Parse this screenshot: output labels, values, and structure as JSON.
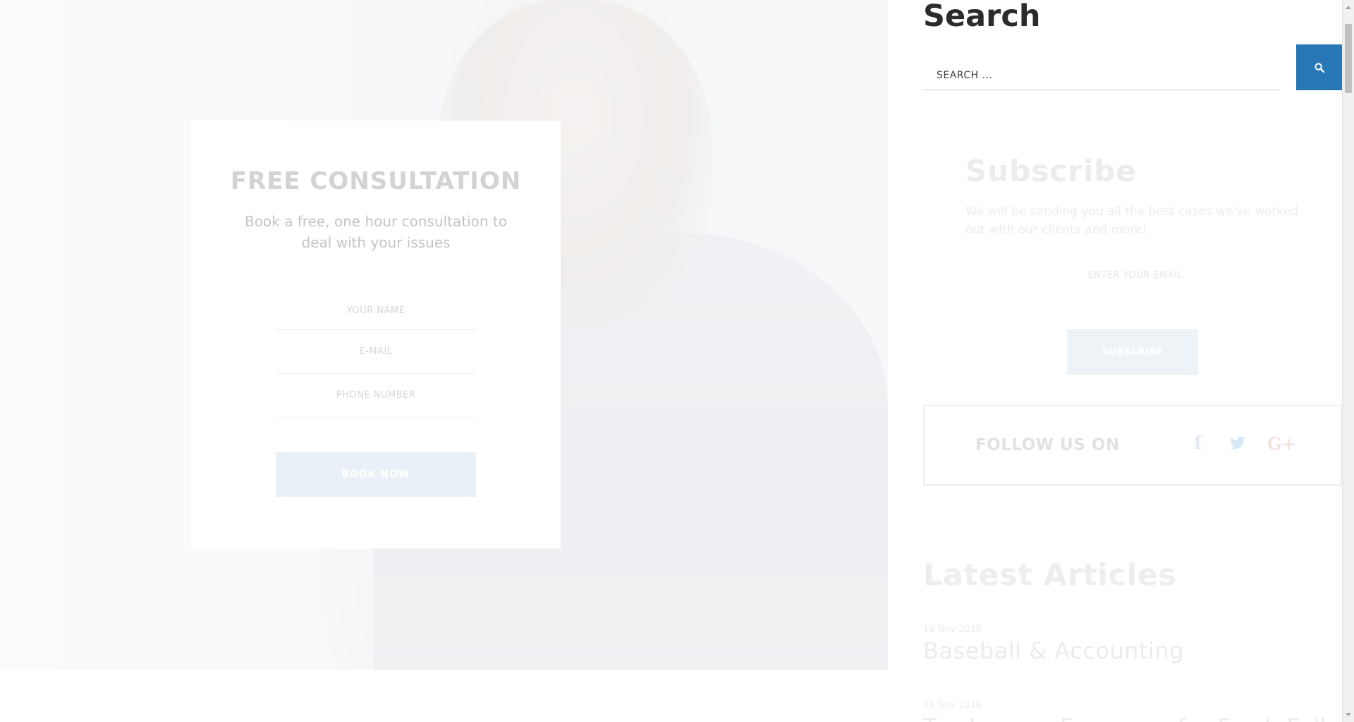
{
  "consultation": {
    "title": "FREE CONSULTATION",
    "subtitle": "Book a free, one hour consultation to deal with your issues",
    "name_placeholder": "YOUR NAME",
    "email_placeholder": "E-MAIL",
    "phone_placeholder": "PHONE NUMBER",
    "button_label": "BOOK NOW"
  },
  "search": {
    "title": "Search",
    "placeholder": "SEARCH ...",
    "button_icon": "search-icon",
    "accent_color": "#2878b8"
  },
  "subscribe": {
    "title": "Subscribe",
    "text": "We will be sending you all the best cases we've worked out with our clients and more!",
    "email_placeholder": "ENTER YOUR EMAIL",
    "button_label": "SUBSCRIBE"
  },
  "follow": {
    "label": "FOLLOW US ON",
    "networks": [
      {
        "name": "facebook",
        "icon": "facebook-icon",
        "glyph": "f"
      },
      {
        "name": "twitter",
        "icon": "twitter-icon"
      },
      {
        "name": "google-plus",
        "icon": "google-plus-icon",
        "glyph": "G+"
      }
    ]
  },
  "latest": {
    "title": "Latest Articles",
    "articles": [
      {
        "date": "16 Nov 2016",
        "title": "Baseball & Accounting"
      },
      {
        "date": "16 Nov 2016",
        "title": "Tax Lawyer Expenses for Fresh Folks"
      }
    ]
  }
}
